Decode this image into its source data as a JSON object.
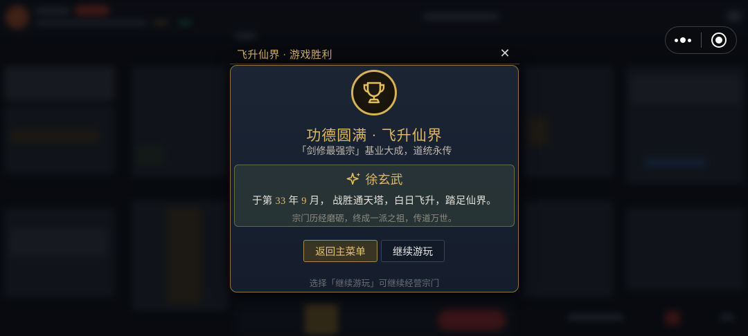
{
  "dialog": {
    "title": "飞升仙界 · 游戏胜利",
    "close_icon": "close-icon",
    "trophy_icon": "trophy-icon",
    "headline": "功德圆满 · 飞升仙界",
    "subline": "「剑修最强宗」基业大成，道统永传",
    "hero": {
      "sparkle_icon": "sparkle-icon",
      "name": "徐玄武",
      "line_prefix": "于第 ",
      "year": "33",
      "line_mid": " 年 ",
      "month": "9",
      "line_suffix": " 月， 战胜通天塔，白日飞升，踏足仙界。",
      "note": "宗门历经磨砺，终成一派之祖，传道万世。"
    },
    "buttons": {
      "main_menu": "返回主菜单",
      "continue": "继续游玩"
    },
    "hint": "选择「继续游玩」可继续经营宗门"
  },
  "capsule": {
    "menu_icon": "more-dots-icon",
    "close_icon": "target-close-icon"
  },
  "colors": {
    "gold": "#dcb866",
    "panel_border": "#8d7541",
    "panel_bg": "#1a2332"
  }
}
